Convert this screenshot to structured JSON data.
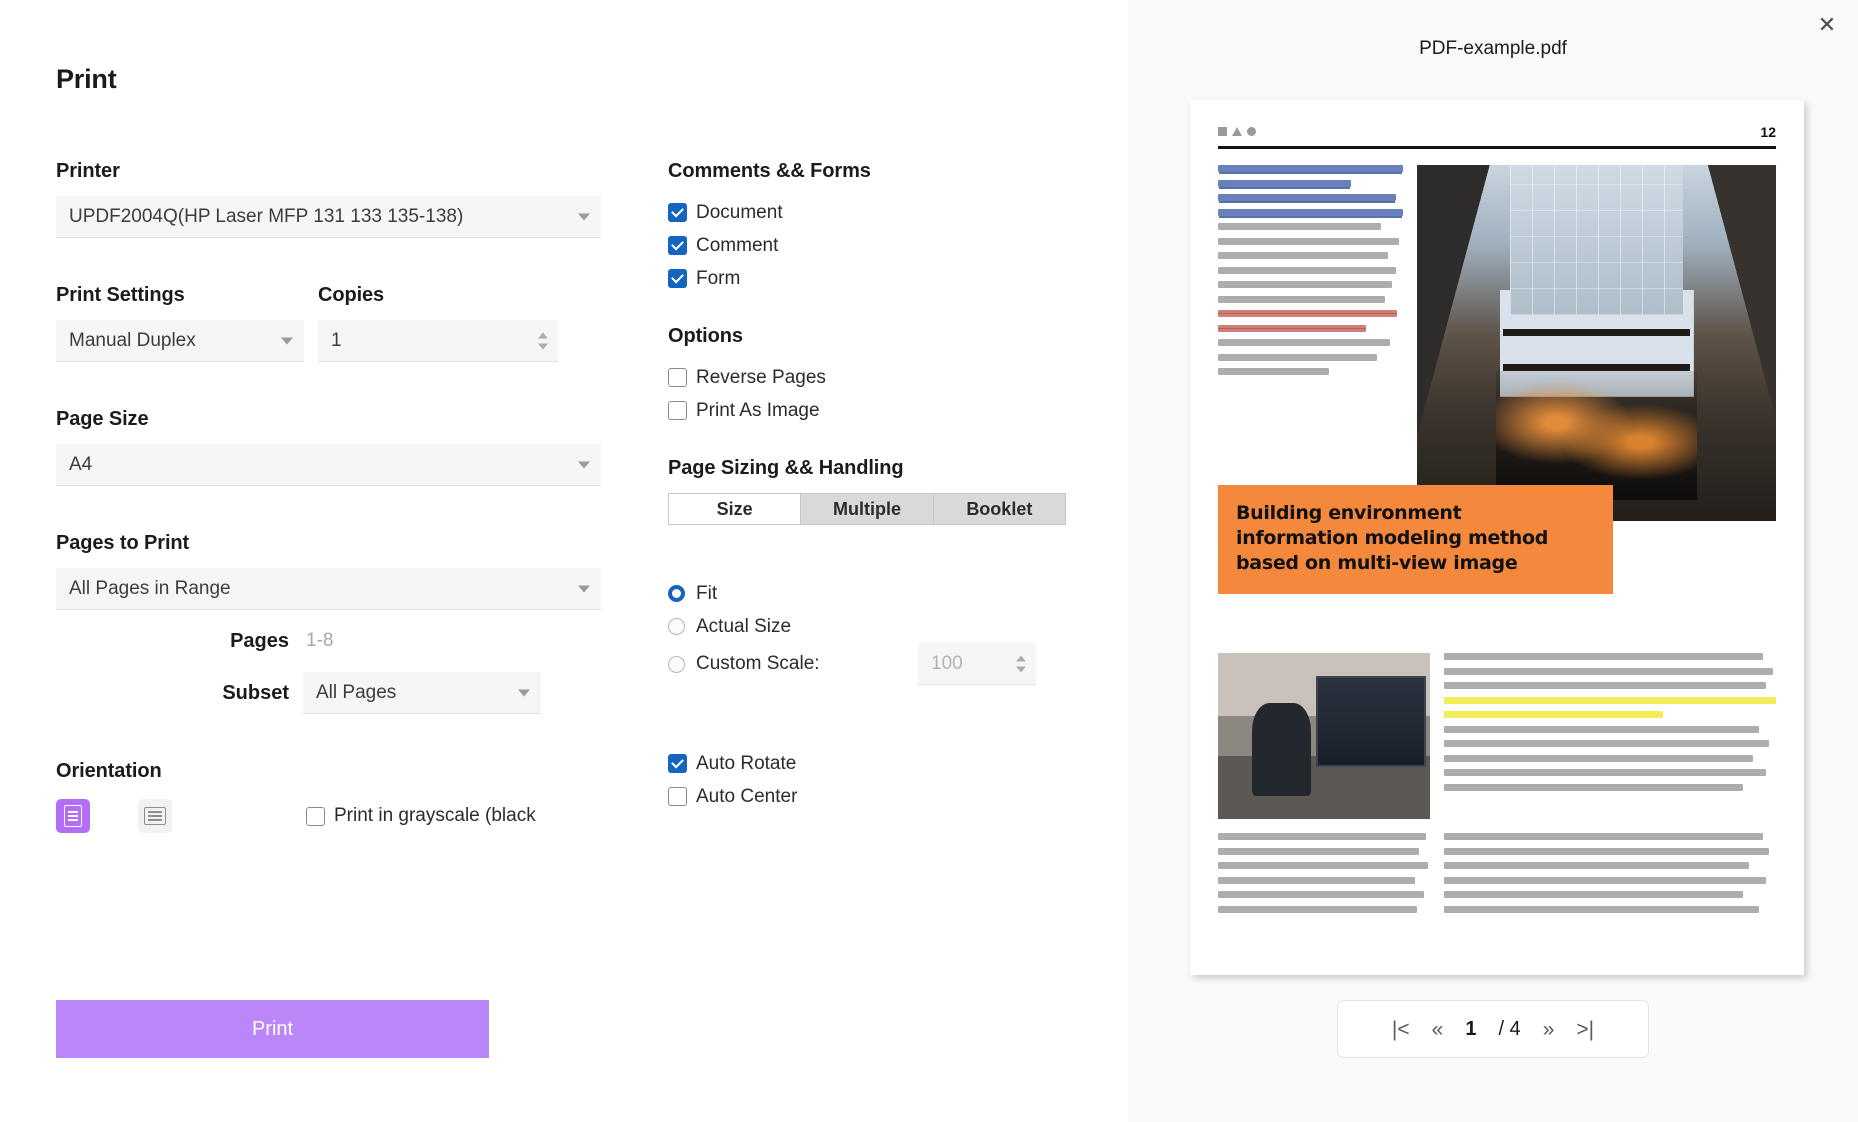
{
  "dialog": {
    "title": "Print",
    "print_button": "Print",
    "close_icon": "close-icon"
  },
  "printer": {
    "label": "Printer",
    "value": "UPDF2004Q(HP Laser MFP 131 133 135-138)"
  },
  "print_settings": {
    "label": "Print Settings",
    "value": "Manual Duplex"
  },
  "copies": {
    "label": "Copies",
    "value": "1"
  },
  "page_size": {
    "label": "Page Size",
    "value": "A4"
  },
  "pages_to_print": {
    "label": "Pages to Print",
    "value": "All Pages in Range",
    "pages_label": "Pages",
    "pages_placeholder": "1-8",
    "subset_label": "Subset",
    "subset_value": "All Pages"
  },
  "orientation": {
    "label": "Orientation",
    "portrait_icon": "portrait-orientation-icon",
    "landscape_icon": "landscape-orientation-icon",
    "selected": "portrait",
    "grayscale_label": "Print in grayscale (black",
    "grayscale_checked": false
  },
  "comments_forms": {
    "label": "Comments && Forms",
    "items": [
      {
        "label": "Document",
        "checked": true
      },
      {
        "label": "Comment",
        "checked": true
      },
      {
        "label": "Form",
        "checked": true
      }
    ]
  },
  "options": {
    "label": "Options",
    "items": [
      {
        "label": "Reverse Pages",
        "checked": false
      },
      {
        "label": "Print As Image",
        "checked": false
      }
    ]
  },
  "page_sizing": {
    "label": "Page Sizing && Handling",
    "tabs": [
      {
        "label": "Size",
        "active": true
      },
      {
        "label": "Multiple",
        "active": false
      },
      {
        "label": "Booklet",
        "active": false
      }
    ],
    "scale_options": [
      {
        "label": "Fit",
        "selected": true
      },
      {
        "label": "Actual Size",
        "selected": false
      },
      {
        "label": "Custom Scale:",
        "selected": false
      }
    ],
    "custom_scale_value": "100",
    "auto_rotate": {
      "label": "Auto Rotate",
      "checked": true
    },
    "auto_center": {
      "label": "Auto Center",
      "checked": false
    }
  },
  "preview": {
    "file_name": "PDF-example.pdf",
    "document_page_number": "12",
    "banner_line1": "Building environment",
    "banner_line2": "information modeling method",
    "banner_line3": "based on multi-view image",
    "pager": {
      "first": "|<",
      "prev": "«",
      "current": "1",
      "total": "/ 4",
      "next": "»",
      "last": ">|"
    }
  },
  "colors": {
    "accent_purple": "#bb86f7",
    "checkbox_blue": "#1565c0",
    "banner_orange": "#f4883c",
    "highlight_yellow": "#f2ea3c"
  }
}
